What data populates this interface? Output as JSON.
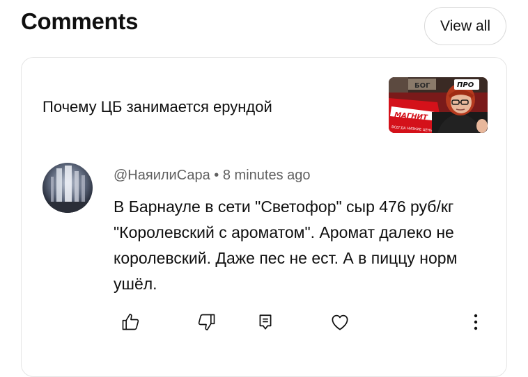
{
  "header": {
    "title": "Comments",
    "view_all_label": "View all"
  },
  "video": {
    "title": "Почему ЦБ занимается ерундой",
    "thumbnail": {
      "sign_top": "БОГ",
      "store_name": "МАГНИТ",
      "store_slogan": "ВСЕГДА НИЗКИЕ ЦЕНЫ",
      "badge": "ПРО"
    }
  },
  "comment": {
    "author": "@НаяилиСара",
    "separator": " • ",
    "time": "8 minutes ago",
    "text": "В Барнауле в сети \"Светофор\" сыр 476 руб/кг \"Королевский с ароматом\". Аромат далеко не королевский. Даже пес не ест. А в пиццу норм ушёл."
  },
  "actions": {
    "icons": [
      "thumbs-up-icon",
      "thumbs-down-icon",
      "reply-icon",
      "heart-icon",
      "more-vertical-icon"
    ]
  },
  "colors": {
    "text": "#0f0f0f",
    "secondary_text": "#606060",
    "border": "#e5e5e5"
  }
}
